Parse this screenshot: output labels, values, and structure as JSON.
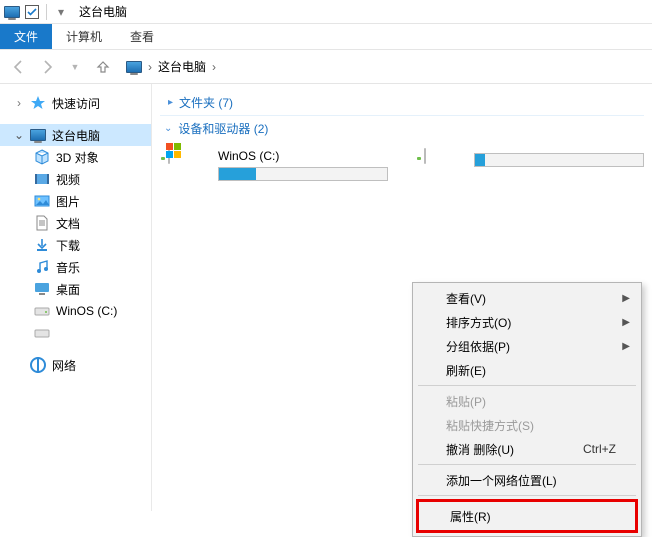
{
  "titlebar": {
    "title": "这台电脑"
  },
  "ribbon": {
    "file": "文件",
    "tabs": [
      "计算机",
      "查看"
    ]
  },
  "address": {
    "location": "这台电脑",
    "sep": "›"
  },
  "sidebar": {
    "quick_access": "快速访问",
    "this_pc": "这台电脑",
    "items": [
      {
        "label": "3D 对象"
      },
      {
        "label": "视频"
      },
      {
        "label": "图片"
      },
      {
        "label": "文档"
      },
      {
        "label": "下载"
      },
      {
        "label": "音乐"
      },
      {
        "label": "桌面"
      },
      {
        "label": "WinOS (C:)"
      }
    ],
    "network": "网络"
  },
  "content": {
    "folders_header": "文件夹 (7)",
    "drives_header": "设备和驱动器 (2)",
    "drive1": {
      "name": "WinOS (C:)",
      "fill_pct": 22
    },
    "drive2": {
      "name": "",
      "fill_pct": 6
    }
  },
  "context_menu": {
    "view": "查看(V)",
    "sort": "排序方式(O)",
    "group": "分组依据(P)",
    "refresh": "刷新(E)",
    "paste": "粘贴(P)",
    "paste_shortcut": "粘贴快捷方式(S)",
    "undo": "撤消 删除(U)",
    "undo_key": "Ctrl+Z",
    "add_network": "添加一个网络位置(L)",
    "properties": "属性(R)"
  }
}
